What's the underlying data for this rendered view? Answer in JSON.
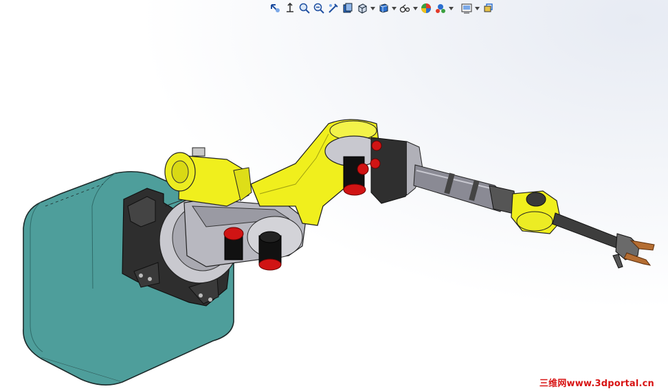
{
  "viewport": {
    "model": "robot-arm-assembly"
  },
  "heads_up_toolbar": {
    "tools": [
      {
        "name": "zoom-to-fit-icon"
      },
      {
        "name": "zoom-to-area-icon"
      },
      {
        "name": "zoom-in-out-icon"
      },
      {
        "name": "zoom-previous-icon"
      },
      {
        "name": "section-view-icon"
      },
      {
        "name": "view-orientation-icon"
      },
      {
        "name": "display-style-icon"
      },
      {
        "name": "hide-show-items-icon"
      },
      {
        "name": "edit-appearance-icon"
      },
      {
        "name": "apply-scene-icon"
      },
      {
        "name": "view-settings-icon"
      },
      {
        "name": "rotate-view-icon"
      }
    ]
  },
  "colors": {
    "base_teal": "#4e9e9b",
    "robot_yellow": "#f0ef1d",
    "bolt_red": "#d01414",
    "casting_grey": "#b8b8c0",
    "dark_parts": "#2e2e2e"
  },
  "watermark": {
    "text": "三维网www.3dportal.cn"
  }
}
